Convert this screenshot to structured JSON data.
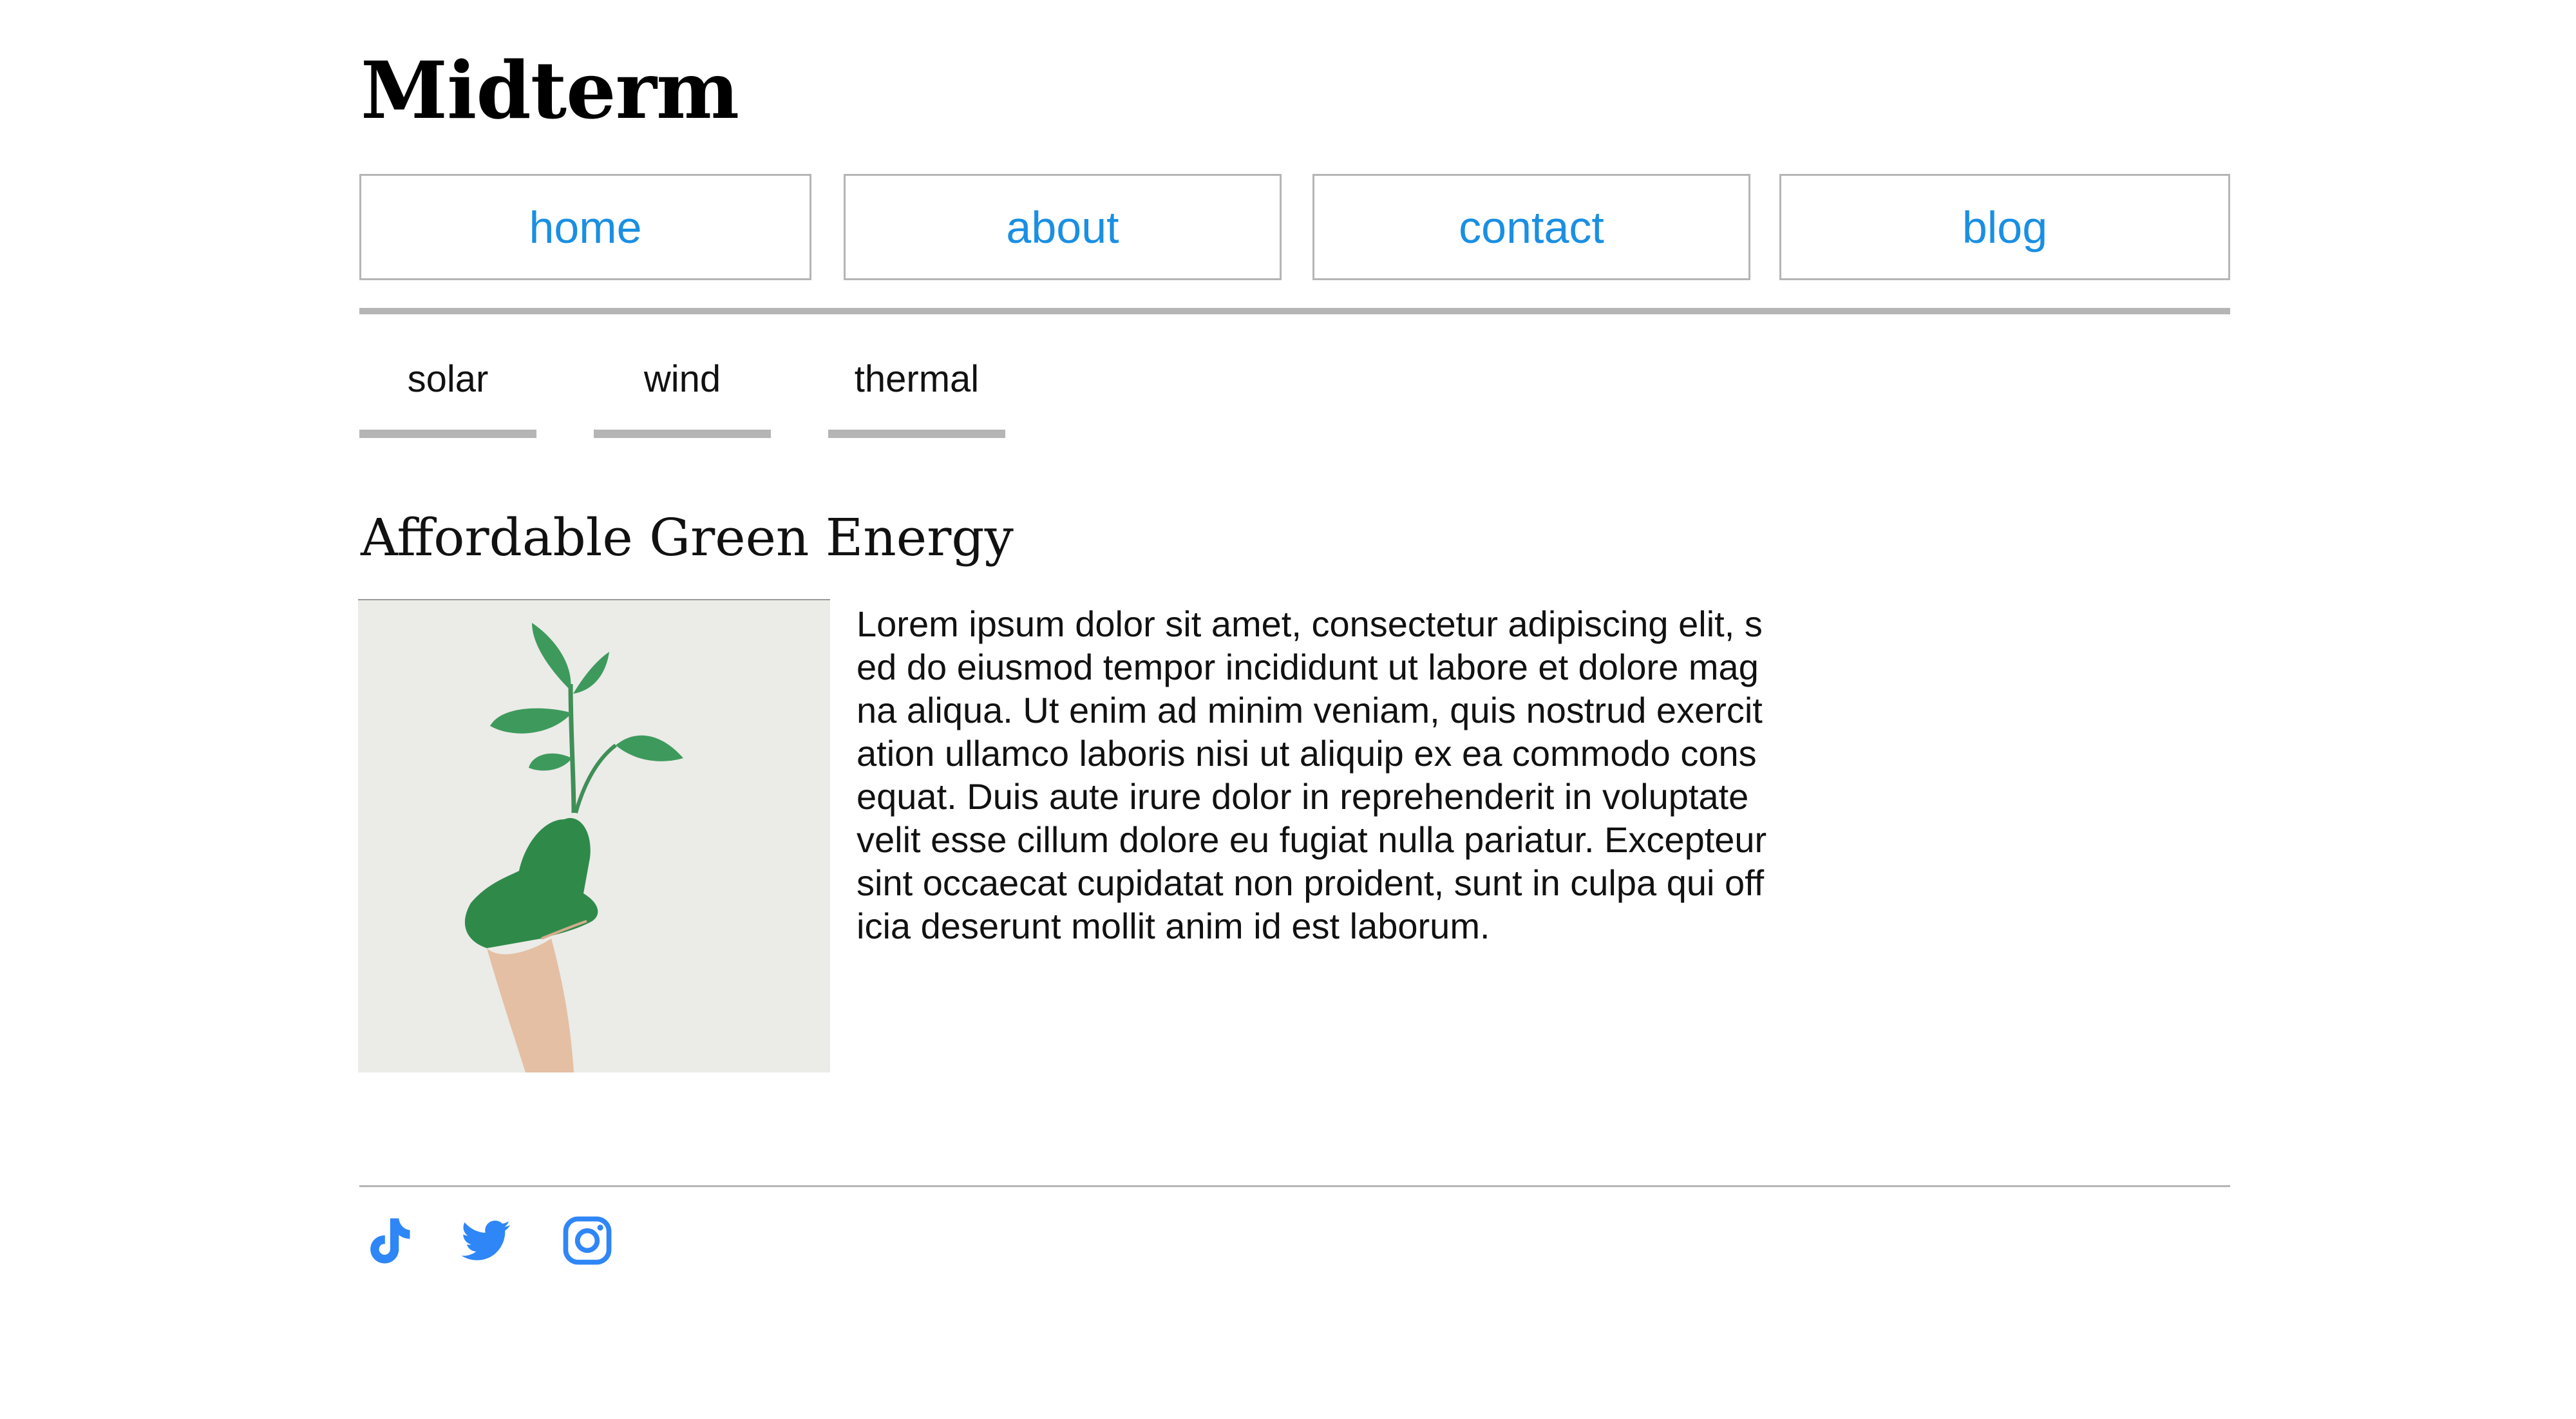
{
  "site": {
    "title": "Midterm"
  },
  "nav": {
    "items": [
      {
        "label": "home"
      },
      {
        "label": "about"
      },
      {
        "label": "contact"
      },
      {
        "label": "blog"
      }
    ],
    "link_color": "#1a8fe3"
  },
  "subnav": {
    "items": [
      {
        "label": "solar"
      },
      {
        "label": "wind"
      },
      {
        "label": "thermal"
      }
    ]
  },
  "article": {
    "heading": "Affordable Green Energy",
    "image": {
      "icon": "green-painted-hand-holding-plant"
    },
    "body": "Lorem ipsum dolor sit amet, consectetur adipiscing elit, sed do eiusmod tempor incididunt ut labore et dolore magna aliqua. Ut enim ad minim veniam, quis nostrud exercitation ullamco laboris nisi ut aliquip ex ea commodo consequat. Duis aute irure dolor in reprehenderit in voluptate velit esse cillum dolore eu fugiat nulla pariatur. Excepteur sint occaecat cupidatat non proident, sunt in culpa qui officia deserunt mollit anim id est laborum."
  },
  "footer": {
    "social": [
      {
        "icon": "tiktok-icon"
      },
      {
        "icon": "twitter-icon"
      },
      {
        "icon": "instagram-icon"
      }
    ],
    "icon_color": "#2f86f6"
  }
}
